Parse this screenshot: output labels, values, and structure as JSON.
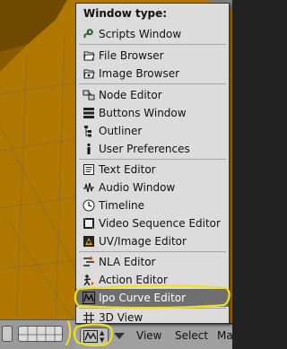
{
  "menu": {
    "title": "Window type:",
    "items": [
      {
        "label": "Scripts Window",
        "icon": "python-snake-icon"
      },
      {
        "label": "File Browser",
        "icon": "file-browser-icon"
      },
      {
        "label": "Image Browser",
        "icon": "image-browser-icon"
      },
      {
        "label": "Node Editor",
        "icon": "node-editor-icon"
      },
      {
        "label": "Buttons Window",
        "icon": "buttons-window-icon"
      },
      {
        "label": "Outliner",
        "icon": "outliner-icon"
      },
      {
        "label": "User Preferences",
        "icon": "info-icon"
      },
      {
        "label": "Text Editor",
        "icon": "text-editor-icon"
      },
      {
        "label": "Audio Window",
        "icon": "audio-window-icon"
      },
      {
        "label": "Timeline",
        "icon": "timeline-clock-icon"
      },
      {
        "label": "Video Sequence Editor",
        "icon": "sequence-editor-icon"
      },
      {
        "label": "UV/Image Editor",
        "icon": "uv-image-editor-icon"
      },
      {
        "label": "NLA Editor",
        "icon": "nla-editor-icon"
      },
      {
        "label": "Action Editor",
        "icon": "action-editor-icon"
      },
      {
        "label": "Ipo Curve Editor",
        "icon": "ipo-curve-icon",
        "selected": true
      },
      {
        "label": "3D View",
        "icon": "3d-view-grid-icon"
      }
    ]
  },
  "header": {
    "view_label": "View",
    "select_label": "Select",
    "mesh_label": "Ma"
  },
  "colors": {
    "viewport_bg": "#b07800",
    "menu_bg": "#dcdcdc",
    "menu_selected": "#6f6f6f",
    "annotation_yellow": "#f2e01c"
  }
}
